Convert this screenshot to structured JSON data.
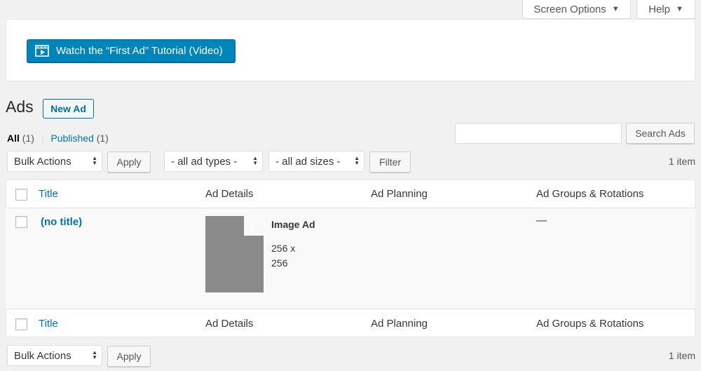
{
  "screen_meta": {
    "screen_options_label": "Screen Options",
    "help_label": "Help"
  },
  "tutorial": {
    "button_label": "Watch the “First Ad” Tutorial (Video)"
  },
  "page": {
    "title": "Ads",
    "new_button": "New Ad"
  },
  "views": {
    "all_label": "All",
    "all_count": "(1)",
    "separator": "|",
    "published_label": "Published",
    "published_count": "(1)"
  },
  "search": {
    "placeholder": "",
    "button_label": "Search Ads"
  },
  "tablenav_top": {
    "bulk_actions": "Bulk Actions",
    "apply_label": "Apply",
    "ad_types_filter": "- all ad types -",
    "ad_sizes_filter": "- all ad sizes -",
    "filter_label": "Filter",
    "items_count": "1 item"
  },
  "table": {
    "columns": [
      "Title",
      "Ad Details",
      "Ad Planning",
      "Ad Groups & Rotations"
    ],
    "rows": [
      {
        "title": "(no title)",
        "ad_type": "Image Ad",
        "ad_size": "256 x 256",
        "groups": "—"
      }
    ]
  },
  "tablenav_bottom": {
    "bulk_actions": "Bulk Actions",
    "apply_label": "Apply",
    "items_count": "1 item"
  },
  "colors": {
    "primary": "#0085ba",
    "link": "#0073aa",
    "background": "#f1f1f1"
  },
  "icons": [
    "video-icon",
    "caret-down-icon",
    "file-icon",
    "select-arrows-icon"
  ]
}
